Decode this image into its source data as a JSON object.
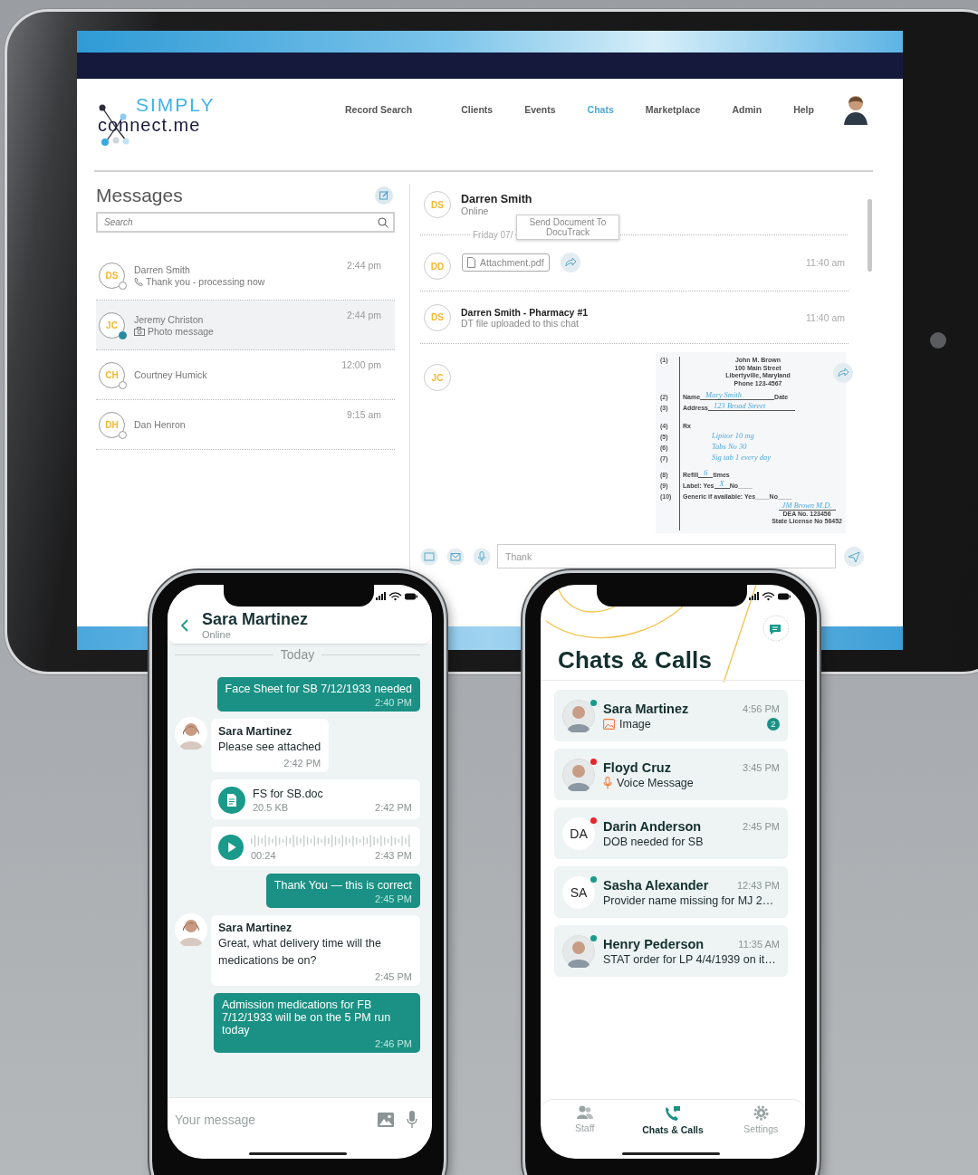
{
  "tablet": {
    "logo": {
      "top": "SIMPLY",
      "bottom": "connect.me"
    },
    "nav": [
      {
        "label": "Record Search",
        "selected": false
      },
      {
        "label": "Clients",
        "selected": false
      },
      {
        "label": "Events",
        "selected": false
      },
      {
        "label": "Chats",
        "selected": true
      },
      {
        "label": "Marketplace",
        "selected": false
      },
      {
        "label": "Admin",
        "selected": false
      },
      {
        "label": "Help",
        "selected": false
      }
    ],
    "messages": {
      "title": "Messages",
      "search": {
        "placeholder": "Search"
      },
      "conversations": [
        {
          "kind": "call",
          "initials": "DS",
          "name": "Darren Smith",
          "preview": "Thank you - processing now",
          "time": "2:44 pm",
          "online": false,
          "selected": false
        },
        {
          "kind": "photo",
          "initials": "JC",
          "name": "Jeremy Christon",
          "preview": "Photo message",
          "time": "2:44 pm",
          "online": true,
          "selected": true
        },
        {
          "kind": "plain",
          "initials": "CH",
          "name": "Courtney Humick",
          "time": "12:00 pm",
          "online": false,
          "selected": false
        },
        {
          "kind": "plain",
          "initials": "DH",
          "name": "Dan Henron",
          "time": "9:15 am",
          "online": false,
          "selected": false
        }
      ]
    },
    "chat": {
      "contact": {
        "initials": "DS",
        "name": "Darren Smith",
        "status": "Online"
      },
      "date_divider": "Friday 07/",
      "tooltip": "Send Document To DocuTrack",
      "entries": [
        {
          "kind": "attachment",
          "initials": "DD",
          "file": "Attachment.pdf",
          "time": "11:40 am"
        },
        {
          "kind": "text",
          "initials": "DS",
          "title": "Darren Smith - Pharmacy #1",
          "text": "DT file uploaded to this chat",
          "time": "11:40 am"
        },
        {
          "kind": "document",
          "initials": "JC",
          "document": {
            "number": "(1)",
            "header": [
              "John M. Brown",
              "100 Main Street",
              "Libertyville, Maryland",
              "Phone 123-4567"
            ],
            "rows": [
              {
                "number": "(2)",
                "label": "Name",
                "written": "Mary Smith",
                "trail": "Date"
              },
              {
                "number": "(3)",
                "label": "Address",
                "written": "123 Broad Street"
              },
              {
                "number": "(4)",
                "label": "Rx"
              },
              {
                "number": "(5)",
                "written": "Lipitor 10 mg"
              },
              {
                "number": "(6)",
                "written": "Tabs No 30"
              },
              {
                "number": "(7)",
                "written": "Sig tab 1 every day"
              },
              {
                "number": "(8)",
                "label": "Refill",
                "written": "6",
                "trail": "times"
              },
              {
                "number": "(9)",
                "label": "Label: Yes",
                "written": "X",
                "trail": "No____"
              },
              {
                "number": "(10)",
                "label": "Generic if available: Yes____No____"
              }
            ],
            "signature": "JM Brown M.D.",
            "footer": [
              "DEA No. 123456",
              "State License No 56452"
            ]
          }
        }
      ],
      "composer": {
        "value": "Thank"
      }
    }
  },
  "chat_phone": {
    "header": {
      "name": "Sara Martinez",
      "status": "Online"
    },
    "day": "Today",
    "messages": [
      {
        "kind": "outgoing",
        "text": "Face Sheet for SB 7/12/1933 needed",
        "time": "2:40 PM"
      },
      {
        "kind": "incoming",
        "sender": "Sara Martinez",
        "text": "Please see attached",
        "time": "2:42 PM"
      },
      {
        "kind": "file",
        "name": "FS for SB.doc",
        "size": "20.5 KB",
        "time": "2:42 PM"
      },
      {
        "kind": "audio",
        "duration": "00:24",
        "time": "2:43 PM"
      },
      {
        "kind": "outgoing",
        "text": "Thank You — this is correct",
        "time": "2:45 PM"
      },
      {
        "kind": "incoming",
        "sender": "Sara Martinez",
        "text": "Great, what delivery time will the medications be on?",
        "time": "2:45 PM"
      },
      {
        "kind": "outgoing",
        "text": "Admission medications for FB 7/12/1933 will be on the 5 PM run today",
        "time": "2:46 PM"
      }
    ],
    "composer": {
      "placeholder": "Your message"
    }
  },
  "chats_phone": {
    "title": "Chats & Calls",
    "chats": [
      {
        "kind": "image",
        "name": "Sara Martinez",
        "preview": "Image",
        "time": "4:56 PM",
        "color": "#1a9a8a",
        "unread": "2"
      },
      {
        "kind": "voice",
        "name": "Floyd Cruz",
        "preview": "Voice Message",
        "time": "3:45 PM",
        "color": "#e5262c"
      },
      {
        "kind": "text",
        "initials": "DA",
        "name": "Darin Anderson",
        "preview": "DOB needed for SB",
        "time": "2:45 PM",
        "color": "#e5262c"
      },
      {
        "kind": "text",
        "initials": "SA",
        "name": "Sasha Alexander",
        "preview": "Provider name missing for MJ 2…",
        "time": "12:43 PM",
        "color": "#1a9a8a"
      },
      {
        "kind": "text",
        "name": "Henry Pederson",
        "preview": "STAT order for LP 4/4/1939 on it…",
        "time": "11:35 AM",
        "color": "#1a9a8a"
      }
    ],
    "tabs": [
      {
        "kind": "staff",
        "label": "Staff",
        "selected": false
      },
      {
        "kind": "calls",
        "label": "Chats & Calls",
        "selected": true
      },
      {
        "kind": "settings",
        "label": "Settings",
        "selected": false
      }
    ]
  }
}
